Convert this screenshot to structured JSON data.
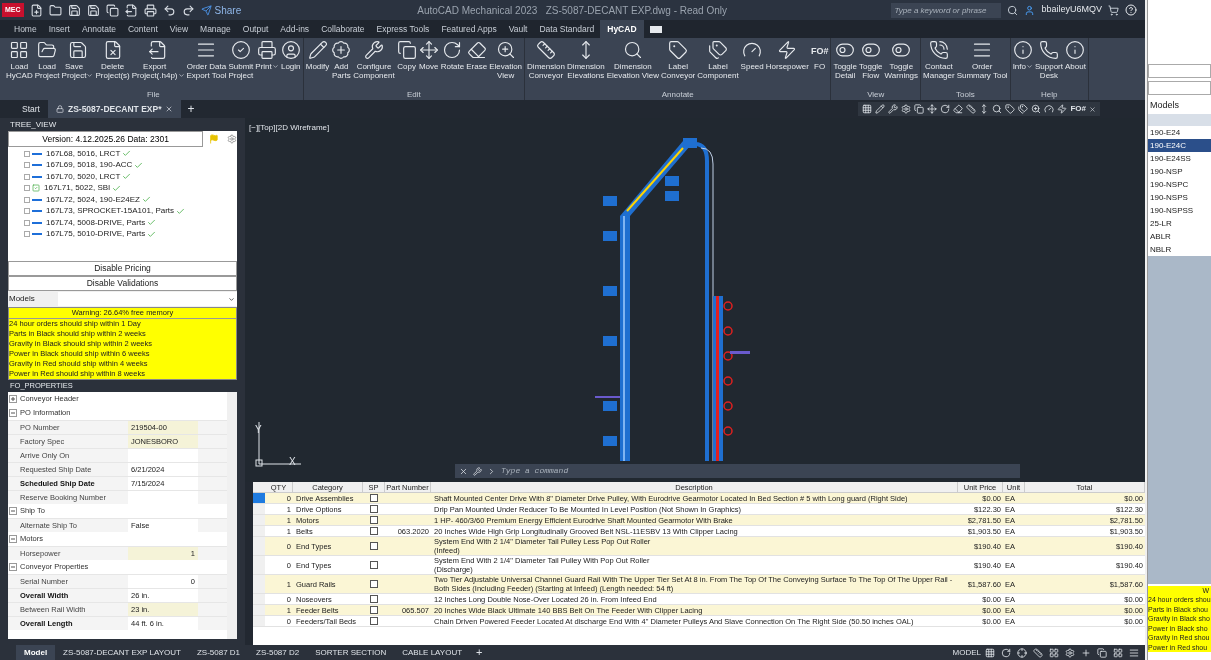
{
  "title_bar": {
    "app_badge": "MEC",
    "share": "Share",
    "title": "AutoCAD Mechanical 2023   ZS-5087-DECANT EXP.dwg - Read Only",
    "search": {
      "placeholder": "Type a keyword or phrase"
    },
    "user": "bbaileyU6MQV"
  },
  "menu_tabs": [
    {
      "label": "Home",
      "selected": false
    },
    {
      "label": "Insert",
      "selected": false
    },
    {
      "label": "Annotate",
      "selected": false
    },
    {
      "label": "Content",
      "selected": false
    },
    {
      "label": "View",
      "selected": false
    },
    {
      "label": "Manage",
      "selected": false
    },
    {
      "label": "Output",
      "selected": false
    },
    {
      "label": "Add-ins",
      "selected": false
    },
    {
      "label": "Collaborate",
      "selected": false
    },
    {
      "label": "Express Tools",
      "selected": false
    },
    {
      "label": "Featured Apps",
      "selected": false
    },
    {
      "label": "Vault",
      "selected": false
    },
    {
      "label": "Data Standard",
      "selected": false
    },
    {
      "label": "HyCAD",
      "selected": true
    }
  ],
  "ribbon": [
    {
      "label": "File",
      "buttons": [
        {
          "label": "Load\nHyCAD",
          "dropdown": false
        },
        {
          "label": "Load\nProject",
          "dropdown": false
        },
        {
          "label": "Save\nProject",
          "dropdown": true
        },
        {
          "label": "Delete\nProject(s)",
          "dropdown": false
        },
        {
          "label": "Export\nProject(.h4p)",
          "dropdown": true
        },
        {
          "label": "Order Data\nExport Tool",
          "dropdown": false
        },
        {
          "label": "Submit\nProject",
          "dropdown": false
        },
        {
          "label": "Print",
          "dropdown": true
        },
        {
          "label": "Login",
          "dropdown": false
        }
      ]
    },
    {
      "label": "Edit",
      "buttons": [
        {
          "label": "Modify",
          "dropdown": false
        },
        {
          "label": "Add\nParts",
          "dropdown": false
        },
        {
          "label": "Configure\nComponent",
          "dropdown": false
        },
        {
          "label": "Copy",
          "dropdown": false
        },
        {
          "label": "Move",
          "dropdown": false
        },
        {
          "label": "Rotate",
          "dropdown": false
        },
        {
          "label": "Erase",
          "dropdown": false
        },
        {
          "label": "Elevation\nView",
          "dropdown": false
        }
      ]
    },
    {
      "label": "Annotate",
      "buttons": [
        {
          "label": "Dimension\nConveyor",
          "dropdown": false
        },
        {
          "label": "Dimension\nElevations",
          "dropdown": false
        },
        {
          "label": "Dimension\nElevation View",
          "dropdown": false
        },
        {
          "label": "Label\nConveyor",
          "dropdown": false
        },
        {
          "label": "Label\nComponent",
          "dropdown": false
        },
        {
          "label": "Speed",
          "dropdown": false
        },
        {
          "label": "Horsepower",
          "dropdown": false
        },
        {
          "label": "FO",
          "dropdown": false,
          "icon_text": "FO#"
        }
      ]
    },
    {
      "label": "View",
      "buttons": [
        {
          "label": "Toggle\nDetail",
          "dropdown": false
        },
        {
          "label": "Toggle\nFlow",
          "dropdown": false
        },
        {
          "label": "Toggle\nWarnings",
          "dropdown": false
        }
      ]
    },
    {
      "label": "Tools",
      "buttons": [
        {
          "label": "Contact\nManager",
          "dropdown": false
        },
        {
          "label": "Order\nSummary Tool",
          "dropdown": false
        }
      ]
    },
    {
      "label": "Help",
      "buttons": [
        {
          "label": "Info",
          "dropdown": true
        },
        {
          "label": "Support\nDesk",
          "dropdown": false
        },
        {
          "label": "About",
          "dropdown": false
        }
      ]
    }
  ],
  "doc_tabs": [
    {
      "label": "Start",
      "selected": false,
      "locked": false
    },
    {
      "label": "ZS-5087-DECANT EXP*",
      "selected": true,
      "locked": true
    }
  ],
  "doc_tabs_add": "+",
  "canvas_toolbar_text": "FO#",
  "tree_view": {
    "title": "TREE_VIEW",
    "version": "Version: 4.12.2025.26 Data: 2301",
    "items": [
      {
        "label": "167L68, 5016, LRCT",
        "kind": "line",
        "validated": true
      },
      {
        "label": "167L69, 5018, 190-ACC",
        "kind": "line",
        "validated": true
      },
      {
        "label": "167L70, 5020, LRCT",
        "kind": "line",
        "validated": true
      },
      {
        "label": "167L71, 5022, SBI",
        "kind": "box",
        "validated": true
      },
      {
        "label": "167L72, 5024, 190-E24EZ",
        "kind": "line",
        "validated": true
      },
      {
        "label": "167L73, SPROCKET-15A101, Parts",
        "kind": "line",
        "validated": true
      },
      {
        "label": "167L74, 5008-DRIVE, Parts",
        "kind": "line",
        "validated": true
      },
      {
        "label": "167L75, 5010-DRIVE, Parts",
        "kind": "line",
        "validated": true
      }
    ],
    "buttons": [
      "Disable Pricing",
      "Disable Validations"
    ],
    "models_label": "Models",
    "warning": "Warning: 26.64% free memory",
    "notes": [
      "24 hour orders should ship within 1 Day",
      "Parts in Black should ship within 2 weeks",
      "Gravity in Black should ship within 2 weeks",
      "Power in Black should ship within 6 weeks",
      "Gravity in Red should ship within 4 weeks",
      "Power in Red should ship within 8 weeks"
    ]
  },
  "properties": {
    "title": "FO_PROPERTIES",
    "rows": [
      {
        "kind": "section",
        "label": "Conveyor Header",
        "expanded": false
      },
      {
        "kind": "section",
        "label": "PO Information",
        "expanded": true
      },
      {
        "kind": "field",
        "label": "PO Number",
        "value": "219504-00",
        "bold": false,
        "highlighted": true,
        "right_aligned": false
      },
      {
        "kind": "field",
        "label": "Factory Spec",
        "value": "JONESBORO",
        "bold": false,
        "highlighted": true,
        "right_aligned": false
      },
      {
        "kind": "field",
        "label": "Arrive Only On",
        "bold": false,
        "highlighted": false
      },
      {
        "kind": "field",
        "label": "Requested Ship Date",
        "value": "6/21/2024",
        "bold": false,
        "highlighted": false,
        "right_aligned": false
      },
      {
        "kind": "field",
        "label": "Scheduled Ship Date",
        "value": "7/15/2024",
        "bold": true,
        "highlighted": false,
        "right_aligned": false
      },
      {
        "kind": "field",
        "label": "Reserve Booking Number",
        "bold": false,
        "highlighted": false
      },
      {
        "kind": "section",
        "label": "Ship To",
        "expanded": true
      },
      {
        "kind": "field",
        "label": "Alternate Ship To",
        "value": "False",
        "bold": false,
        "highlighted": false,
        "right_aligned": false
      },
      {
        "kind": "section",
        "label": "Motors",
        "expanded": true
      },
      {
        "kind": "field",
        "label": "Horsepower",
        "value": "1",
        "bold": false,
        "highlighted": true,
        "right_aligned": true
      },
      {
        "kind": "section",
        "label": "Conveyor Properties",
        "expanded": true
      },
      {
        "kind": "field",
        "label": "Serial Number",
        "value": "0",
        "bold": false,
        "highlighted": false,
        "right_aligned": true
      },
      {
        "kind": "field",
        "label": "Overall Width",
        "value": "26 in.",
        "bold": true,
        "highlighted": false,
        "right_aligned": false
      },
      {
        "kind": "field",
        "label": "Between Rail Width",
        "value": "23 in.",
        "bold": false,
        "highlighted": true,
        "right_aligned": false
      },
      {
        "kind": "field",
        "label": "Overall Length",
        "value": "44 ft. 6 in.",
        "bold": true,
        "highlighted": false,
        "right_aligned": false
      }
    ]
  },
  "canvas": {
    "view_label": "[−][Top][2D Wireframe]",
    "axis_y": "Y",
    "axis_x": "X",
    "command": {
      "placeholder": "Type a command"
    }
  },
  "parts_table": {
    "columns": [
      "QTY",
      "Category",
      "SP",
      "Part Number",
      "Description",
      "Unit Price",
      "Unit",
      "Total"
    ],
    "rows": [
      {
        "qty": "0",
        "category": "Drive Assemblies",
        "sp": false,
        "part_number": "",
        "description": "Shaft Mounted Center Drive With 8\" Diameter Drive Pulley, With Eurodrive Gearmotor Located In Bed Section # 5 with Long guard (Right Side)",
        "unit_price": "$0.00",
        "unit": "EA",
        "total": "$0.00",
        "highlighted": true,
        "selected": true
      },
      {
        "qty": "1",
        "category": "Drive Options",
        "sp": false,
        "part_number": "",
        "description": "Drip Pan Mounted Under Reducer To Be Mounted In Level Position (Not Shown In Graphics)",
        "unit_price": "$122.30",
        "unit": "EA",
        "total": "$122.30",
        "highlighted": false,
        "selected": false
      },
      {
        "qty": "1",
        "category": "Motors",
        "sp": false,
        "part_number": "",
        "description": "1 HP- 460/3/60 Premium Energy Efficient Eurodrive Shaft Mounted Gearmotor With Brake",
        "unit_price": "$2,781.50",
        "unit": "EA",
        "total": "$2,781.50",
        "highlighted": true,
        "selected": false
      },
      {
        "qty": "1",
        "category": "Belts",
        "sp": false,
        "part_number": "063.2020",
        "description": "20 Inches Wide High Grip Longitudinally Grooved Belt NSL-11ESBV 13 With Clipper Lacing",
        "unit_price": "$1,903.50",
        "unit": "EA",
        "total": "$1,903.50",
        "highlighted": false,
        "selected": false
      },
      {
        "qty": "0",
        "category": "End Types",
        "sp": false,
        "part_number": "",
        "description": "System End With 2 1/4\" Diameter Tail Pulley Less Pop Out Roller\n (Infeed)",
        "unit_price": "$190.40",
        "unit": "EA",
        "total": "$190.40",
        "highlighted": true,
        "selected": false
      },
      {
        "qty": "0",
        "category": "End Types",
        "sp": false,
        "part_number": "",
        "description": "System End With 2 1/4\" Diameter Tail Pulley With Pop Out Roller\n (Discharge)",
        "unit_price": "$190.40",
        "unit": "EA",
        "total": "$190.40",
        "highlighted": false,
        "selected": false
      },
      {
        "qty": "1",
        "category": "Guard Rails",
        "sp": false,
        "part_number": "",
        "description": "Two Tier Adjustable Universal Channel Guard Rail With The Upper Tier Set At 8 in. From The Top Of The Conveying Surface To The Top Of The Upper Rail - Both Sides (Including Feeder) (Starting at Infeed) (Length needed: 54 ft)",
        "unit_price": "$1,587.60",
        "unit": "EA",
        "total": "$1,587.60",
        "highlighted": true,
        "selected": false
      },
      {
        "qty": "0",
        "category": "Noseovers",
        "sp": false,
        "part_number": "",
        "description": "12 Inches Long Double Nose-Over Located 26 in. From Infeed End",
        "unit_price": "$0.00",
        "unit": "EA",
        "total": "$0.00",
        "highlighted": false,
        "selected": false
      },
      {
        "qty": "1",
        "category": "Feeder Belts",
        "sp": false,
        "part_number": "065.507",
        "description": "20 Inches Wide Black Ultimate 140 BBS Belt On The Feeder With Clipper Lacing",
        "unit_price": "$0.00",
        "unit": "EA",
        "total": "$0.00",
        "highlighted": true,
        "selected": false
      },
      {
        "qty": "0",
        "category": "Feeders/Tail Beds",
        "sp": false,
        "part_number": "",
        "description": "Chain Driven Powered Feeder Located At discharge End With 4\" Diameter Pulleys And Slave Connection On The Right Side (50.50 inches OAL)",
        "unit_price": "$0.00",
        "unit": "EA",
        "total": "$0.00",
        "highlighted": false,
        "selected": false
      }
    ]
  },
  "layout_tabs": [
    {
      "label": "Model",
      "selected": true
    },
    {
      "label": "ZS-5087-DECANT EXP LAYOUT",
      "selected": false
    },
    {
      "label": "ZS-5087 D1",
      "selected": false
    },
    {
      "label": "ZS-5087 D2",
      "selected": false
    },
    {
      "label": "SORTER SECTION",
      "selected": false
    },
    {
      "label": "CABLE LAYOUT",
      "selected": false
    }
  ],
  "layout_add": "+",
  "status_mode": "MODEL",
  "side_window": {
    "models_label": "Models",
    "items": [
      {
        "label": "190-E24",
        "selected": false
      },
      {
        "label": "190-E24C",
        "selected": true
      },
      {
        "label": "190-E24SS",
        "selected": false
      },
      {
        "label": "190-NSP",
        "selected": false
      },
      {
        "label": "190-NSPC",
        "selected": false
      },
      {
        "label": "190-NSPS",
        "selected": false
      },
      {
        "label": "190-NSPSS",
        "selected": false
      },
      {
        "label": "25-LR",
        "selected": false
      },
      {
        "label": "ABLR",
        "selected": false
      },
      {
        "label": "NBLR",
        "selected": false
      }
    ],
    "warning": "W",
    "notes": [
      "24 hour orders shou",
      "Parts in Black shou",
      "Gravity in Black sho",
      "Power in Black sho",
      "Gravity in Red shou",
      "Power in Red shou"
    ]
  }
}
